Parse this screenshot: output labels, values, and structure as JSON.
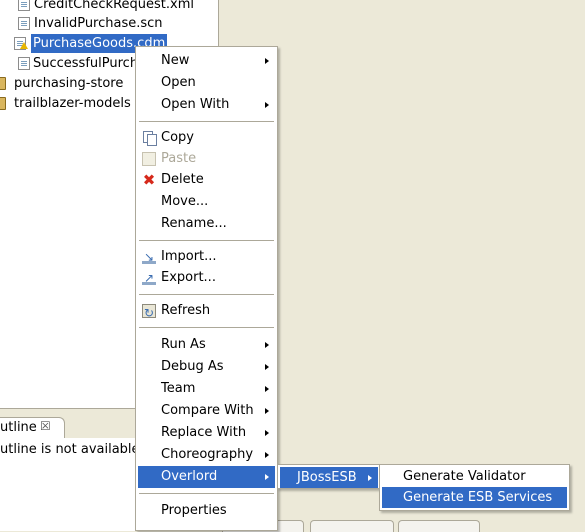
{
  "tree": {
    "items": [
      {
        "label": "CreditCheckRequest.xml",
        "icon": "xml-file-icon"
      },
      {
        "label": "InvalidPurchase.scn",
        "icon": "scn-file-icon"
      },
      {
        "label": "PurchaseGoods.cdm",
        "icon": "cdm-file-warning-icon",
        "selected": true
      },
      {
        "label": "SuccessfulPurcha",
        "icon": "scn-file-icon"
      },
      {
        "label": "purchasing-store",
        "icon": "project-icon"
      },
      {
        "label": "trailblazer-models",
        "icon": "project-icon"
      }
    ]
  },
  "outline": {
    "tab_label": "utline",
    "close_glyph": "☒",
    "message": "utline is not available."
  },
  "context_menu": {
    "items": [
      {
        "label": "New",
        "submenu": true
      },
      {
        "label": "Open"
      },
      {
        "label": "Open With",
        "submenu": true
      },
      {
        "label": "Copy",
        "icon": "copy-icon"
      },
      {
        "label": "Paste",
        "icon": "paste-icon",
        "disabled": true
      },
      {
        "label": "Delete",
        "icon": "delete-icon"
      },
      {
        "label": "Move..."
      },
      {
        "label": "Rename..."
      },
      {
        "label": "Import...",
        "icon": "import-icon"
      },
      {
        "label": "Export...",
        "icon": "export-icon"
      },
      {
        "label": "Refresh",
        "icon": "refresh-icon"
      },
      {
        "label": "Run As",
        "submenu": true
      },
      {
        "label": "Debug As",
        "submenu": true
      },
      {
        "label": "Team",
        "submenu": true
      },
      {
        "label": "Compare With",
        "submenu": true
      },
      {
        "label": "Replace With",
        "submenu": true
      },
      {
        "label": "Choreography",
        "submenu": true
      },
      {
        "label": "Overlord",
        "submenu": true,
        "highlighted": true
      },
      {
        "label": "Properties"
      }
    ]
  },
  "submenu_overlord": {
    "items": [
      {
        "label": "JBossESB",
        "submenu": true,
        "highlighted": true
      }
    ]
  },
  "submenu_jbossesb": {
    "items": [
      {
        "label": "Generate Validator"
      },
      {
        "label": "Generate ESB Services",
        "highlighted": true
      }
    ]
  },
  "colors": {
    "selection": "#316ac5",
    "window_bg": "#ece9d8",
    "menu_border": "#aca899"
  }
}
